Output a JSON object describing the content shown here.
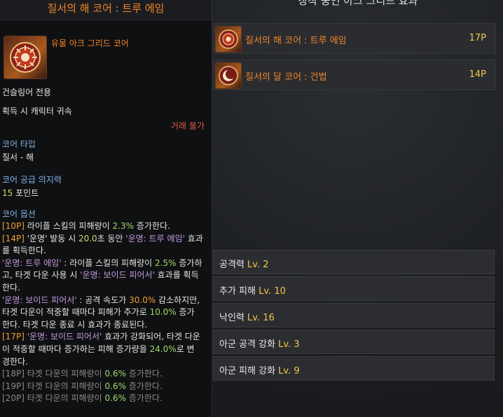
{
  "tooltip": {
    "title": "질서의 해 코어 : 트루 에임",
    "item_name": "유물 아크 그리드 코어",
    "class_req": "건슬링어 전용",
    "bind": "획득 시 캐릭터 귀속",
    "trade": "거래 불가",
    "core_type_label": "코어 타입",
    "core_type_value": "질서 - 해",
    "willpower_label": "코어 공급 의지력",
    "willpower_value": "15",
    "willpower_unit": " 포인트",
    "options_label": "코어 옵션",
    "options": {
      "l1_tag": "[10P]",
      "l1_a": " 라이플 스킬의 피해량이 ",
      "l1_b": "2.3%",
      "l1_c": " 증가한다.",
      "l2_tag": "[14P]",
      "l2_a": " '운명' 발동 시 ",
      "l2_b": "20.0",
      "l2_c": "초 동안 ",
      "l2_d": "'운명: 트루 에임'",
      "l2_e": " 효과",
      "l3": "를 획득한다.",
      "l4_a": "'운명: 트루 에임'",
      "l4_b": " : 라이플 스킬의 피해량이 ",
      "l4_c": "2.5%",
      "l4_d": " 증가하",
      "l5_a": "고, 타겟 다운 사용 시 ",
      "l5_b": "'운명: 보이드 피어서'",
      "l5_c": " 효과를 획득",
      "l6": "한다.",
      "l7_a": "'운명: 보이드 피어서'",
      "l7_b": " : 공격 속도가 ",
      "l7_c": "30.0%",
      "l7_d": " 감소하지만,",
      "l8_a": "타겟 다운이 적중할 때마다 피해가 추가로 ",
      "l8_b": "10.0%",
      "l8_c": " 증가",
      "l9": "한다. 타겟 다운 종료 시 효과가 종료된다.",
      "l10_tag": "[17P]",
      "l10_a": " ",
      "l10_b": "'운명: 보이드 피어서'",
      "l10_c": " 효과가 강화되어, 타겟 다운",
      "l11_a": "이 적중할 때마다 증가하는 피해 증가량을 ",
      "l11_b": "24.0%",
      "l11_c": "로 변",
      "l12": "경한다.",
      "l13_tag": "[18P]",
      "l13_a": " 타겟 다운의 피해량이 ",
      "l13_b": "0.6%",
      "l13_c": " 증가한다.",
      "l14_tag": "[19P]",
      "l14_a": " 타겟 다운의 피해량이 ",
      "l14_b": "0.6%",
      "l14_c": " 증가한다.",
      "l15_tag": "[20P]",
      "l15_a": " 타겟 다운의 피해량이 ",
      "l15_b": "0.6%",
      "l15_c": " 증가한다."
    }
  },
  "panel": {
    "title": "장착 중인 아크 그리드 효과",
    "cores": [
      {
        "name": "질서의 해 코어 : 트루 에임",
        "points": "17P",
        "icon": "sun-core-icon"
      },
      {
        "name": "질서의 달 코어 : 건법",
        "points": "14P",
        "icon": "moon-core-icon"
      }
    ],
    "stats": [
      {
        "name": "공격력",
        "level": "Lv. 2"
      },
      {
        "name": "추가 피해",
        "level": "Lv. 10"
      },
      {
        "name": "낙인력",
        "level": "Lv. 16"
      },
      {
        "name": "아군 공격 강화",
        "level": "Lv. 3"
      },
      {
        "name": "아군 피해 강화",
        "level": "Lv. 9"
      }
    ]
  },
  "colors": {
    "orange_title": "#f0862a",
    "level_yellow": "#f3c64b",
    "tag_orange": "#f0a030",
    "fate_purple": "#c39be0",
    "value_green": "#9fd86a"
  }
}
